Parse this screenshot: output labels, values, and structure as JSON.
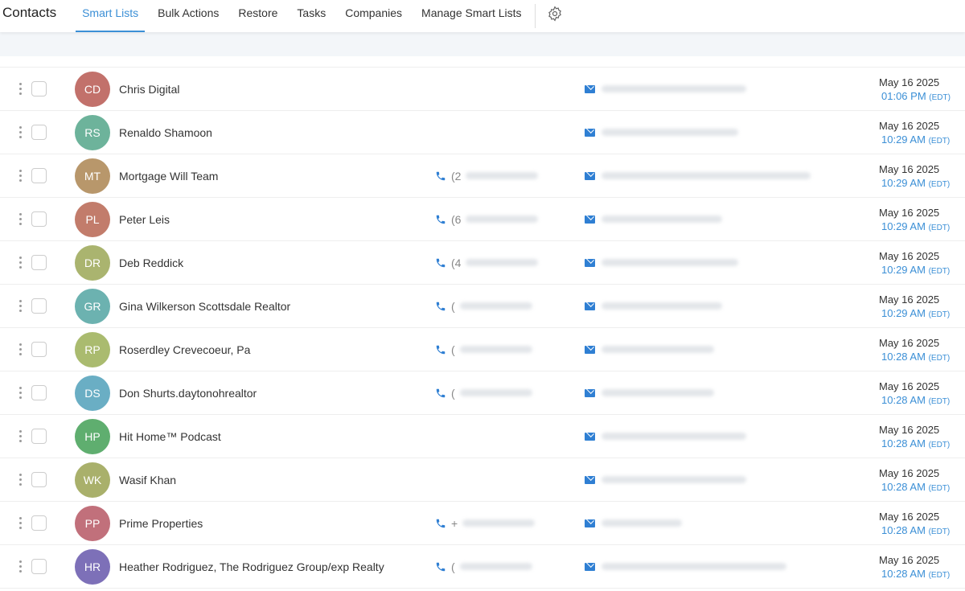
{
  "header": {
    "title": "Contacts",
    "tabs": [
      "Smart Lists",
      "Bulk Actions",
      "Restore",
      "Tasks",
      "Companies",
      "Manage Smart Lists"
    ],
    "active_tab": "Smart Lists",
    "settings_icon": "gear-icon"
  },
  "colors": {
    "accent": "#3b8fd6"
  },
  "contacts": [
    {
      "initials": "CD",
      "name": "Chris Digital",
      "phone": "",
      "color": "#c2716b",
      "date": "May 16 2025",
      "time": "01:06 PM",
      "tz": "(EDT)"
    },
    {
      "initials": "RS",
      "name": "Renaldo Shamoon",
      "phone": "",
      "color": "#6db39b",
      "date": "May 16 2025",
      "time": "10:29 AM",
      "tz": "(EDT)"
    },
    {
      "initials": "MT",
      "name": "Mortgage Will Team",
      "phone": "(2",
      "color": "#b8976b",
      "date": "May 16 2025",
      "time": "10:29 AM",
      "tz": "(EDT)"
    },
    {
      "initials": "PL",
      "name": "Peter Leis",
      "phone": "(6",
      "color": "#c27c6b",
      "date": "May 16 2025",
      "time": "10:29 AM",
      "tz": "(EDT)"
    },
    {
      "initials": "DR",
      "name": "Deb Reddick",
      "phone": "(4",
      "color": "#aab46f",
      "date": "May 16 2025",
      "time": "10:29 AM",
      "tz": "(EDT)"
    },
    {
      "initials": "GR",
      "name": "Gina Wilkerson Scottsdale Realtor",
      "phone": "(",
      "color": "#6cb2b0",
      "date": "May 16 2025",
      "time": "10:29 AM",
      "tz": "(EDT)"
    },
    {
      "initials": "RP",
      "name": "Roserdley Crevecoeur, Pa",
      "phone": "(",
      "color": "#aabb6f",
      "date": "May 16 2025",
      "time": "10:28 AM",
      "tz": "(EDT)"
    },
    {
      "initials": "DS",
      "name": "Don Shurts.daytonohrealtor",
      "phone": "(",
      "color": "#6aaec4",
      "date": "May 16 2025",
      "time": "10:28 AM",
      "tz": "(EDT)"
    },
    {
      "initials": "HP",
      "name": "Hit Home™  Podcast",
      "phone": "",
      "color": "#5fae6f",
      "date": "May 16 2025",
      "time": "10:28 AM",
      "tz": "(EDT)"
    },
    {
      "initials": "WK",
      "name": "Wasif Khan",
      "phone": "",
      "color": "#a9b06b",
      "date": "May 16 2025",
      "time": "10:28 AM",
      "tz": "(EDT)"
    },
    {
      "initials": "PP",
      "name": "Prime Properties",
      "phone": "+",
      "color": "#c1707b",
      "date": "May 16 2025",
      "time": "10:28 AM",
      "tz": "(EDT)"
    },
    {
      "initials": "HR",
      "name": "Heather Rodriguez, The Rodriguez Group/exp Realty",
      "phone": "(",
      "color": "#7d70b8",
      "date": "May 16 2025",
      "time": "10:28 AM",
      "tz": "(EDT)"
    }
  ]
}
